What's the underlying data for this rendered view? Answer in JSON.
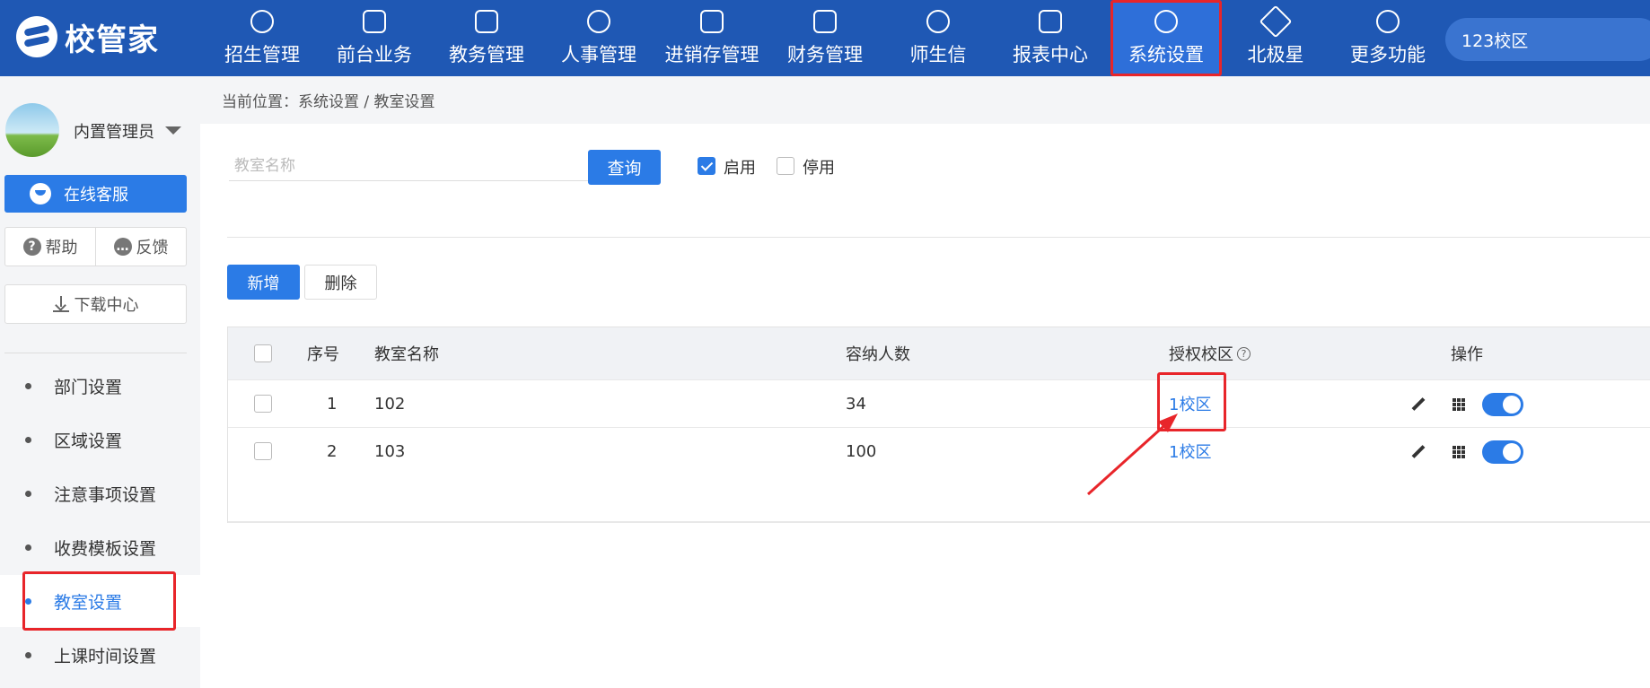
{
  "topbar": {
    "logo_text": "校管家",
    "nav": [
      {
        "label": "招生管理",
        "icon": "person-add-icon"
      },
      {
        "label": "前台业务",
        "icon": "document-icon"
      },
      {
        "label": "教务管理",
        "icon": "book-icon"
      },
      {
        "label": "人事管理",
        "icon": "person-icon"
      },
      {
        "label": "进销存管理",
        "icon": "arrow-box-icon"
      },
      {
        "label": "财务管理",
        "icon": "yen-shield-icon"
      },
      {
        "label": "师生信",
        "icon": "chat-icon"
      },
      {
        "label": "报表中心",
        "icon": "chart-icon"
      },
      {
        "label": "系统设置",
        "icon": "settings-icon",
        "active": true
      },
      {
        "label": "北极星",
        "icon": "star-icon"
      },
      {
        "label": "更多功能",
        "icon": "more-icon"
      }
    ],
    "campus": "123校区"
  },
  "sidebar": {
    "user_name": "内置管理员",
    "cs_label": "在线客服",
    "help_label": "帮助",
    "feedback_label": "反馈",
    "download_label": "下载中心",
    "menu": [
      {
        "label": "部门设置"
      },
      {
        "label": "区域设置"
      },
      {
        "label": "注意事项设置"
      },
      {
        "label": "收费模板设置"
      },
      {
        "label": "教室设置",
        "active": true
      },
      {
        "label": "上课时间设置"
      }
    ]
  },
  "breadcrumb": "当前位置：系统设置 / 教室设置",
  "filter": {
    "search_placeholder": "教室名称",
    "query_label": "查询",
    "enabled_label": "启用",
    "enabled_checked": true,
    "disabled_label": "停用",
    "disabled_checked": false
  },
  "actions": {
    "add_label": "新增",
    "delete_label": "删除"
  },
  "table": {
    "headers": {
      "index": "序号",
      "name": "教室名称",
      "capacity": "容纳人数",
      "campus": "授权校区",
      "ops": "操作"
    },
    "rows": [
      {
        "index": "1",
        "name": "102",
        "capacity": "34",
        "campus": "1校区",
        "enabled": true
      },
      {
        "index": "2",
        "name": "103",
        "capacity": "100",
        "campus": "1校区",
        "enabled": true
      }
    ]
  },
  "colors": {
    "topbar": "#1f58b4",
    "primary": "#2b7be6",
    "highlight": "#e8252a"
  }
}
